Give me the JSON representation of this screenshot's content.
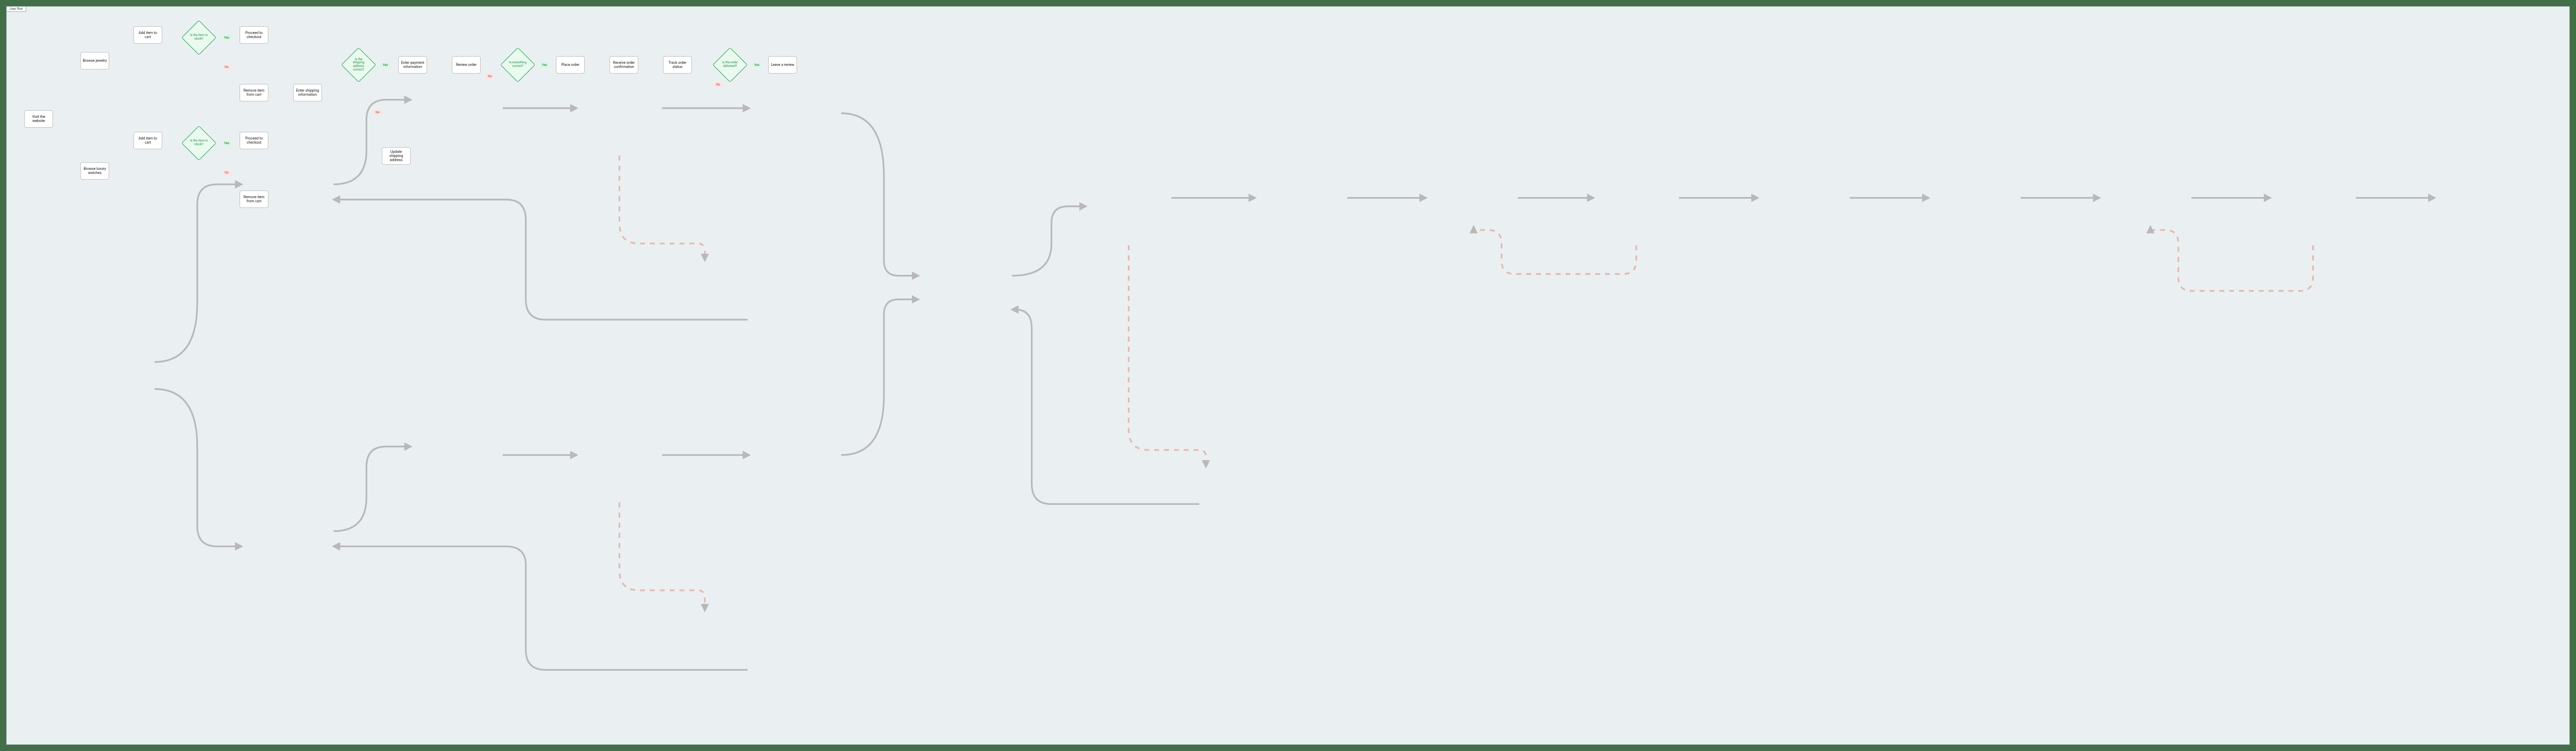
{
  "title": "User flow",
  "labels": {
    "yes": "Yes",
    "no": "No"
  },
  "nodes": {
    "visit": "Visit the website",
    "browseJewel": "Browse jewelry",
    "browseWatch": "Browse luxury watches",
    "addCart1": "Add item to cart",
    "addCart2": "Add item to cart",
    "stock1": "Is the item in stock?",
    "stock2": "Is the item in stock?",
    "checkout1": "Proceed to checkout",
    "checkout2": "Proceed to checkout",
    "remove1": "Remove item from cart",
    "remove2": "Remove item from cart",
    "shipInfo": "Enter shipping information",
    "shipOK": "Is the shipping address correct?",
    "payment": "Enter payment information",
    "updShip": "Update shipping address",
    "review": "Review order",
    "allOK": "Is everything correct?",
    "place": "Place order",
    "confirm": "Receive order confirmation",
    "track": "Track order status",
    "delivered": "Is the order delivered?",
    "reviewLeave": "Leave a review"
  }
}
